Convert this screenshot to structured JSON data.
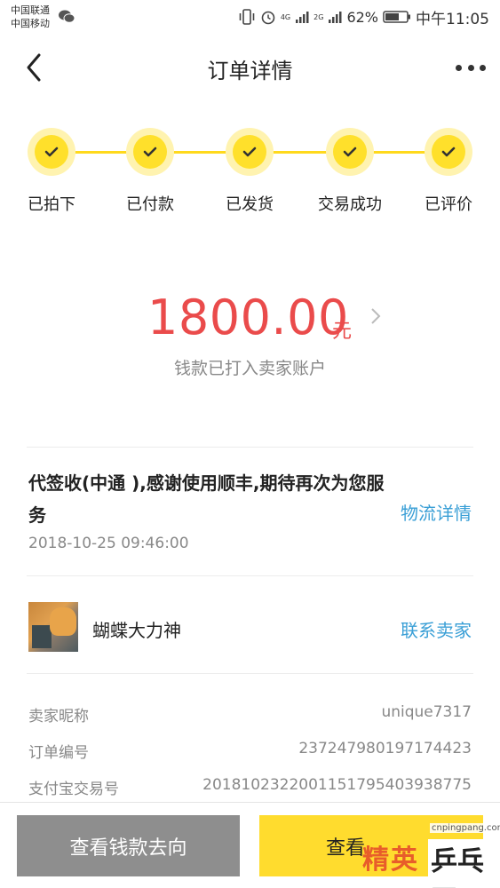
{
  "status_bar": {
    "carrier1": "中国联通",
    "carrier2": "中国移动",
    "net1": "4G",
    "net2": "2G",
    "battery": "62%",
    "time": "中午11:05"
  },
  "nav": {
    "title": "订单详情"
  },
  "steps": [
    {
      "label": "已拍下"
    },
    {
      "label": "已付款"
    },
    {
      "label": "已发货"
    },
    {
      "label": "交易成功"
    },
    {
      "label": "已评价"
    }
  ],
  "amount": {
    "value": "1800.00",
    "unit": "元",
    "description": "钱款已打入卖家账户"
  },
  "logistics": {
    "message": "代签收(中通 ),感谢使用顺丰,期待再次为您服务",
    "link": "物流详情",
    "time": "2018-10-25 09:46:00"
  },
  "seller": {
    "name": "蝴蝶大力神",
    "contact": "联系卖家"
  },
  "info": [
    {
      "label": "卖家昵称",
      "value": "unique7317"
    },
    {
      "label": "订单编号",
      "value": "237247980197174423"
    },
    {
      "label": "支付宝交易号",
      "value": "2018102322001151795403938775"
    }
  ],
  "buttons": {
    "left": "查看钱款去向",
    "right": "查看"
  },
  "watermark": {
    "domain": "cnpingpang.com",
    "cn1": "精英",
    "cn2": "乒乓网"
  },
  "colors": {
    "accent": "#ffdc2e",
    "amount": "#ea4b4b",
    "link": "#3a9fd6"
  }
}
